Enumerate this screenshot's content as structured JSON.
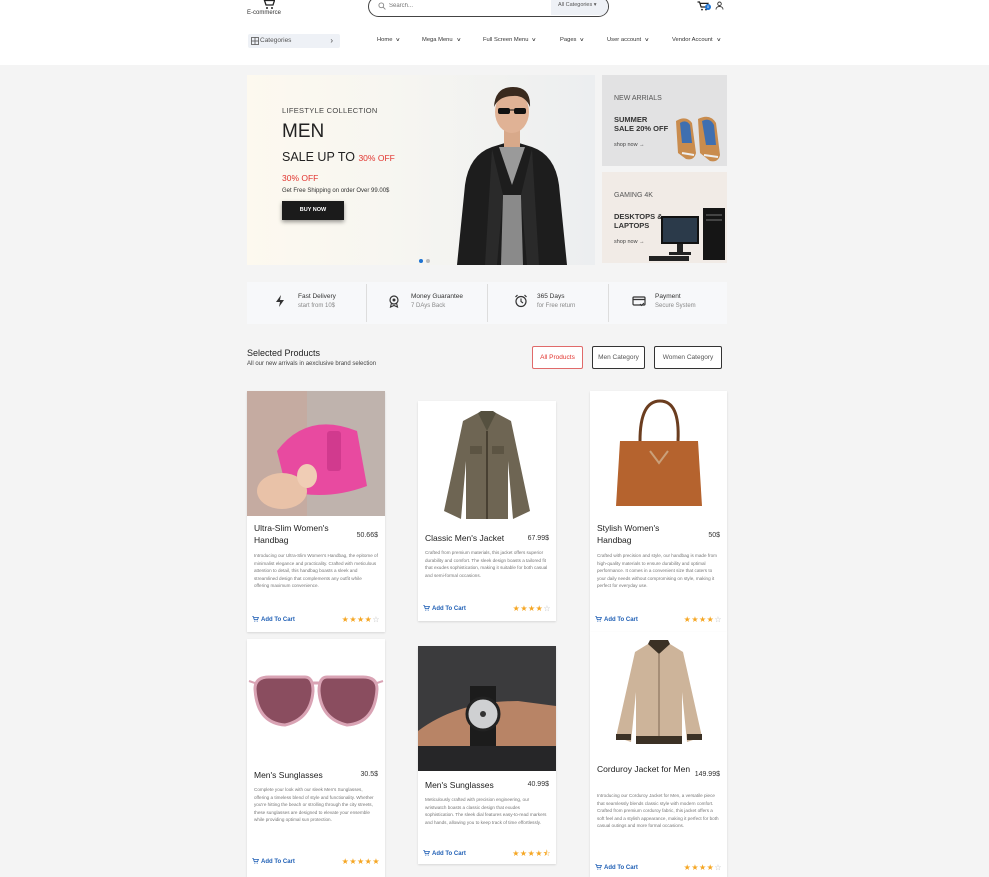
{
  "header": {
    "brand": "E-commerce",
    "search_placeholder": "Search...",
    "category_select": "All Categories",
    "cart_count": "0"
  },
  "nav": {
    "categories_label": "Categories",
    "items": [
      {
        "label": "Home"
      },
      {
        "label": "Mega Menu"
      },
      {
        "label": "Full Screen Menu"
      },
      {
        "label": "Pages"
      },
      {
        "label": "User account"
      },
      {
        "label": "Vendor Account"
      }
    ]
  },
  "hero": {
    "kicker": "LIFESTYLE COLLECTION",
    "title": "MEN",
    "sale": "SALE UP TO",
    "sale_highlight": "30% OFF",
    "off": "30% OFF",
    "shipping": "Get Free Shipping on order Over 99.00$",
    "button": "BUY NOW"
  },
  "side_banners": [
    {
      "kicker": "NEW ARRIALS",
      "line1": "SUMMER",
      "line2": "SALE 20% OFF",
      "link": "shop now →"
    },
    {
      "kicker": "GAMING 4K",
      "line1": "DESKTOPS &",
      "line2": "LAPTOPS",
      "link": "shop now →"
    }
  ],
  "features": [
    {
      "title": "Fast Delivery",
      "subtitle": "start from 10$",
      "icon": "lightning-icon"
    },
    {
      "title": "Money Guarantee",
      "subtitle": "7 DAys Back",
      "icon": "medal-icon"
    },
    {
      "title": "365 Days",
      "subtitle": "for Free return",
      "icon": "alarm-clock-icon"
    },
    {
      "title": "Payment",
      "subtitle": "Secure System",
      "icon": "credit-card-icon"
    }
  ],
  "selected": {
    "title": "Selected Products",
    "subtitle": "All our new arrivals in aexclusive brand selection",
    "tabs": [
      "All Products",
      "Men Category",
      "Women Category"
    ]
  },
  "add_to_cart": "Add To Cart",
  "products": [
    {
      "name": "Ultra-Slim Women's Handbag",
      "price": "50.66$",
      "rating": 4,
      "desc": "Introducing our Ultra-Slim Women's Handbag, the epitome of minimalist elegance and practicality. Crafted with meticulous attention to detail, this handbag boasts a sleek and streamlined design that complements any outfit while offering maximum convenience."
    },
    {
      "name": "Classic Men's Jacket",
      "price": "67.99$",
      "rating": 4,
      "desc": "Crafted from premium materials, this jacket offers superior durability and comfort. The sleek design boasts a tailored fit that exudes sophistication, making it suitable for both casual and semi-formal occasions."
    },
    {
      "name": "Stylish Women's Handbag",
      "price": "50$",
      "rating": 4,
      "desc": "Crafted with precision and style, our handbag is made from high-quality materials to ensure durability and optimal performance. It comes in a convenient size that caters to your daily needs without compromising on style, making it perfect for everyday use."
    },
    {
      "name": "Men's Sunglasses",
      "price": "30.5$",
      "rating": 5,
      "desc": "Complete your look with our sleek Men's Sunglasses, offering a timeless blend of style and functionality. Whether you're hitting the beach or strolling through the city streets, these sunglasses are designed to elevate your ensemble while providing optimal sun protection."
    },
    {
      "name": "Men's Sunglasses",
      "price": "40.99$",
      "rating": 4.5,
      "desc": "Meticulously crafted with precision engineering, our wristwatch boasts a classic design that exudes sophistication. The sleek dial features easy-to-read markers and hands, allowing you to keep track of time effortlessly."
    },
    {
      "name": "Corduroy Jacket for Men",
      "price": "149.99$",
      "rating": 4,
      "desc": "Introducing our Corduroy Jacket for Men, a versatile piece that seamlessly blends classic style with modern comfort. Crafted from premium corduroy fabric, this jacket offers a soft feel and a stylish appearance, making it perfect for both casual outings and more formal occasions."
    }
  ],
  "colors": {
    "accent": "#1e73d2",
    "sale_red": "#e2342f",
    "star": "#f5a623",
    "link_blue": "#1f5fb5"
  }
}
